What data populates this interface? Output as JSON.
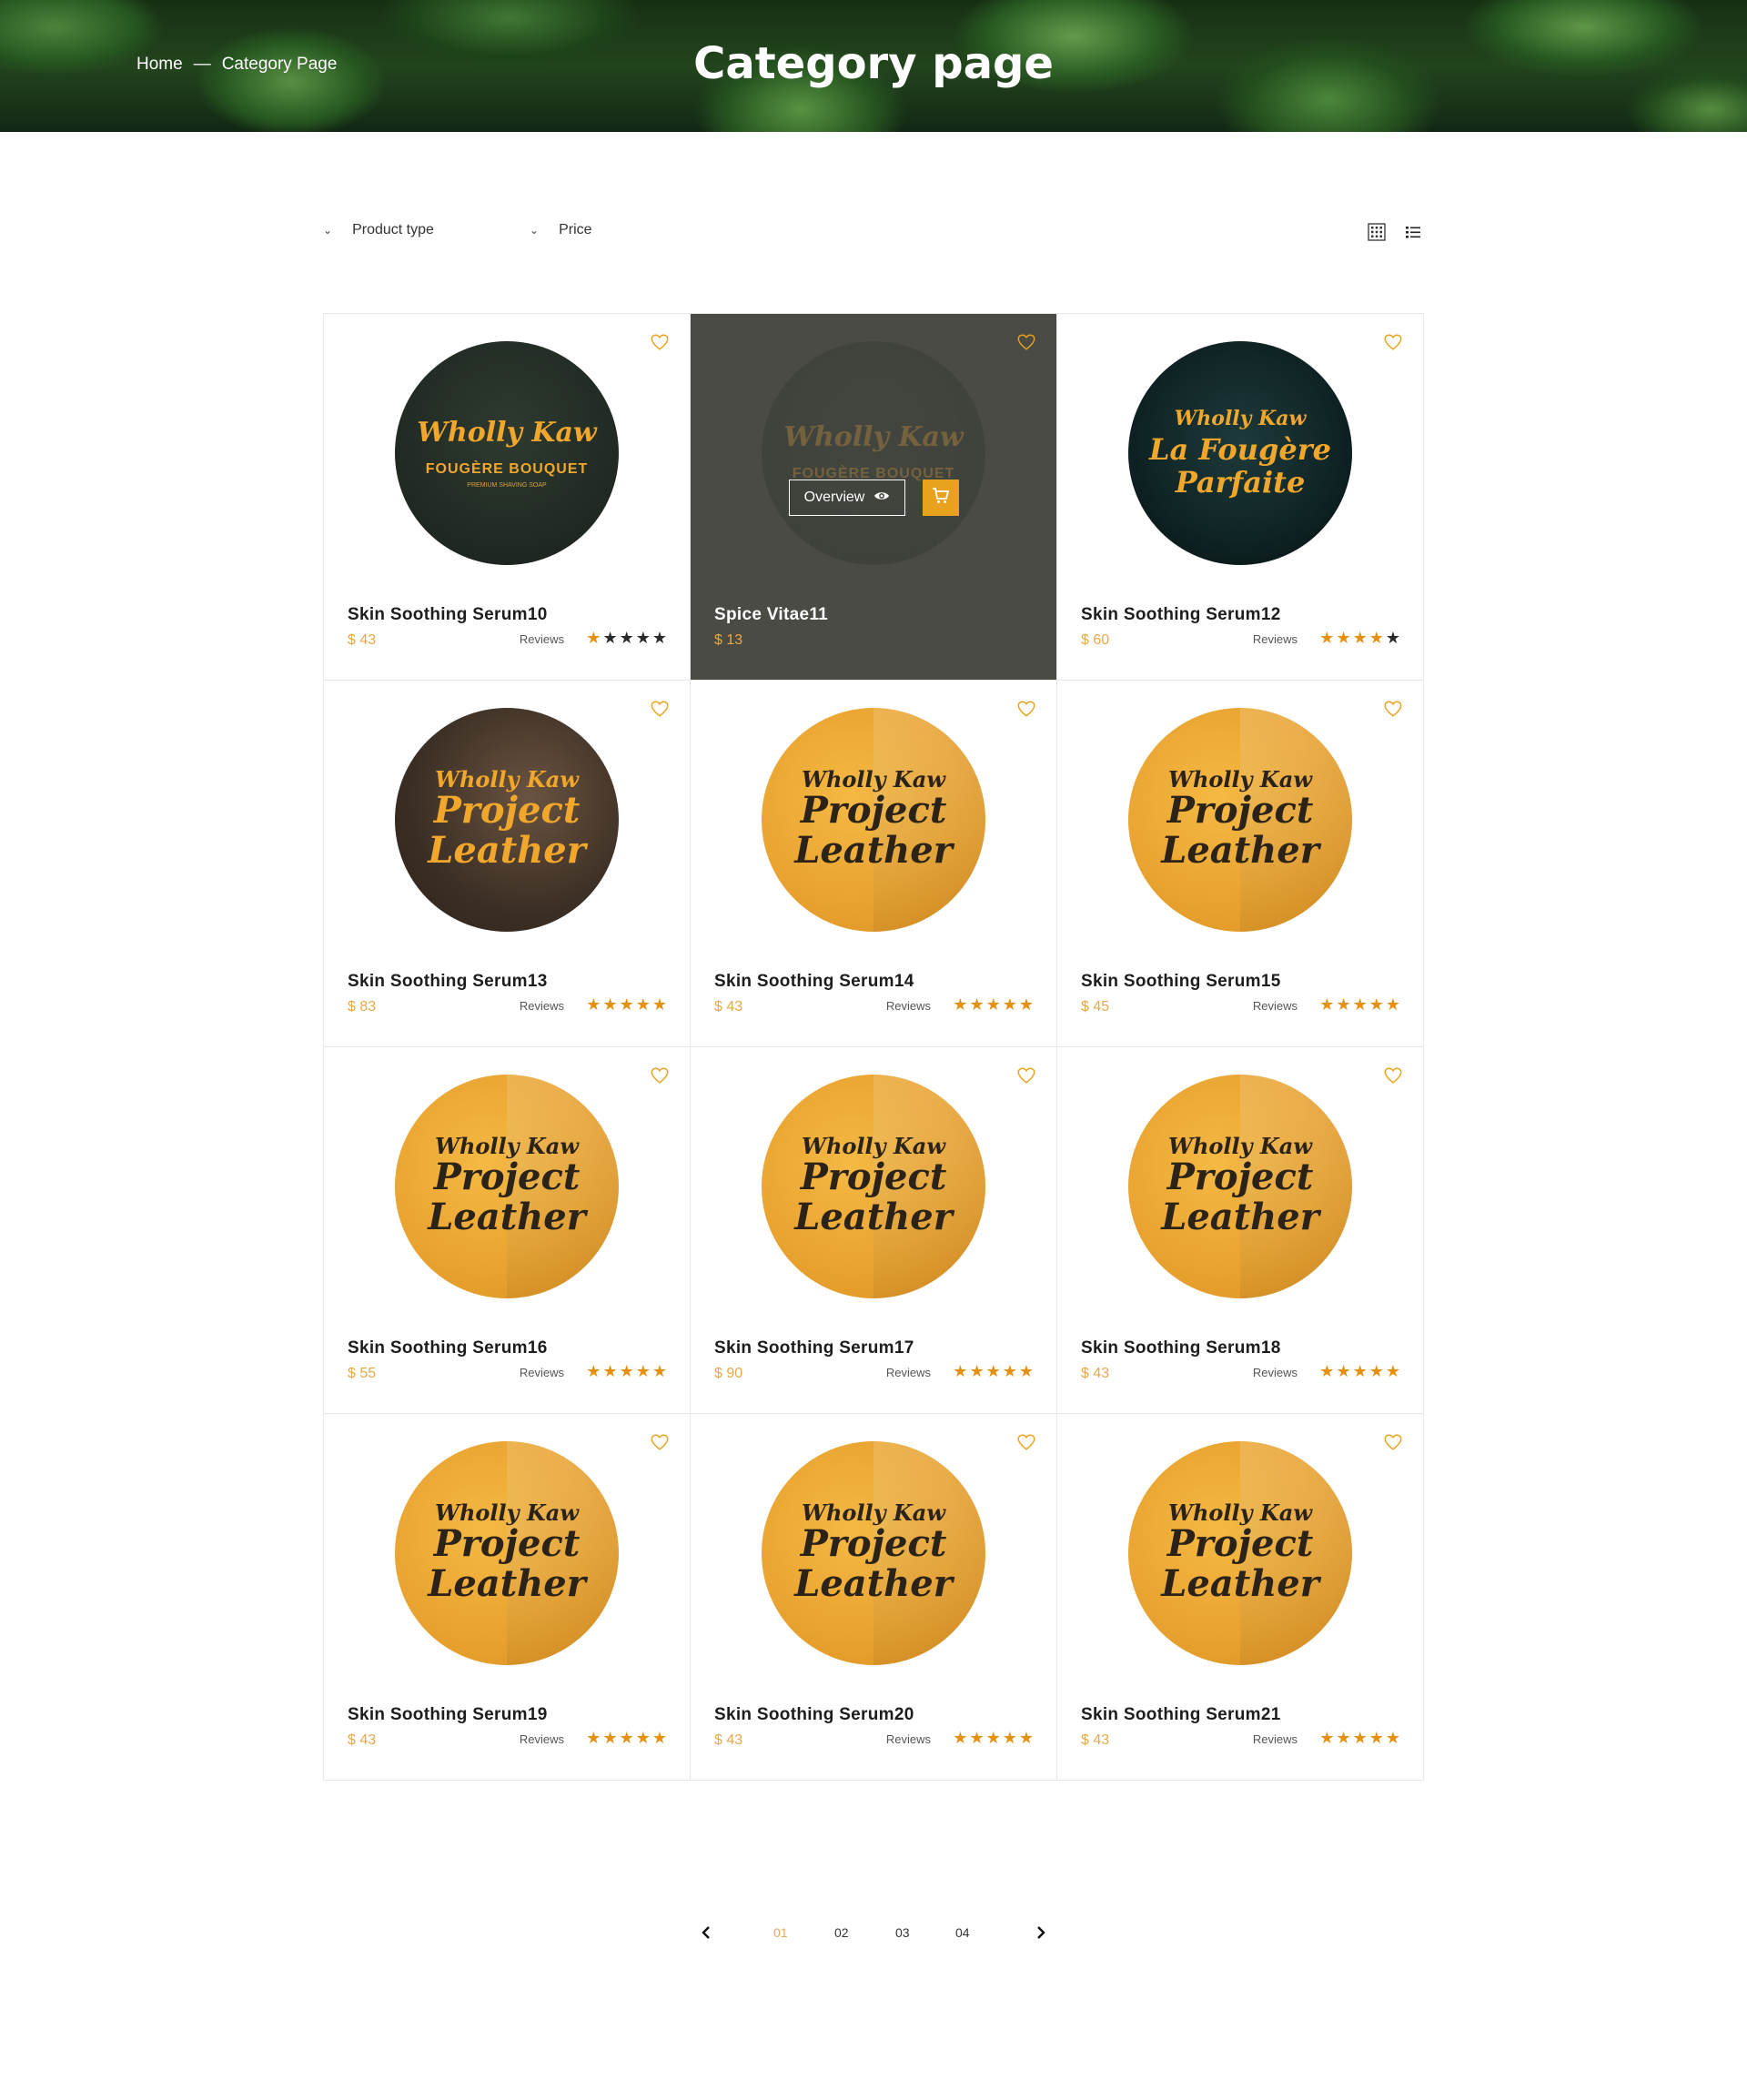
{
  "hero": {
    "breadcrumb": {
      "home": "Home",
      "separator": "—",
      "current": "Category Page"
    },
    "title": "Category page"
  },
  "filters": {
    "product_type": "Product type",
    "price": "Price"
  },
  "view_toggle": {
    "grid_icon": "grid-view-icon",
    "list_icon": "list-view-icon"
  },
  "colors": {
    "accent": "#e9a21e",
    "price": "#e7a84a",
    "star_on": "#e69010",
    "star_off": "#2a2a2a",
    "active_card": "#4b4b45"
  },
  "products": [
    {
      "name": "Skin Soothing Serum10",
      "price": "$ 43",
      "reviews": "Reviews",
      "rating": 1,
      "label_brand": "Wholly Kaw",
      "label_sub": "FOUGÈRE BOUQUET",
      "label_tiny": "PREMIUM SHAVING SOAP",
      "style": "dark"
    },
    {
      "name": "Spice Vitae11",
      "price": "$ 13",
      "reviews": "",
      "rating": null,
      "label_brand": "Wholly Kaw",
      "label_sub": "FOUGÈRE BOUQUET",
      "label_tiny": "",
      "style": "dark",
      "overview": "Overview"
    },
    {
      "name": "Skin Soothing Serum12",
      "price": "$ 60",
      "reviews": "Reviews",
      "rating": 4,
      "label_brand": "Wholly Kaw",
      "label_sub": "La Fougère Parfaite",
      "label_tiny": "",
      "style": "navy"
    },
    {
      "name": "Skin Soothing Serum13",
      "price": "$ 83",
      "reviews": "Reviews",
      "rating": 5,
      "label_brand": "Wholly Kaw",
      "label_sub": "Project Leather",
      "label_tiny": "",
      "style": "brown"
    },
    {
      "name": "Skin Soothing Serum14",
      "price": "$ 43",
      "reviews": "Reviews",
      "rating": 5,
      "label_brand": "Wholly Kaw",
      "label_sub": "Project Leather",
      "label_tiny": "",
      "style": "gold"
    },
    {
      "name": "Skin Soothing Serum15",
      "price": "$ 45",
      "reviews": "Reviews",
      "rating": 5,
      "label_brand": "Wholly Kaw",
      "label_sub": "Project Leather",
      "label_tiny": "",
      "style": "gold"
    },
    {
      "name": "Skin Soothing Serum16",
      "price": "$ 55",
      "reviews": "Reviews",
      "rating": 5,
      "label_brand": "Wholly Kaw",
      "label_sub": "Project Leather",
      "label_tiny": "",
      "style": "gold"
    },
    {
      "name": "Skin Soothing Serum17",
      "price": "$ 90",
      "reviews": "Reviews",
      "rating": 5,
      "label_brand": "Wholly Kaw",
      "label_sub": "Project Leather",
      "label_tiny": "",
      "style": "gold"
    },
    {
      "name": "Skin Soothing Serum18",
      "price": "$ 43",
      "reviews": "Reviews",
      "rating": 5,
      "label_brand": "Wholly Kaw",
      "label_sub": "Project Leather",
      "label_tiny": "",
      "style": "gold"
    },
    {
      "name": "Skin Soothing Serum19",
      "price": "$ 43",
      "reviews": "Reviews",
      "rating": 5,
      "label_brand": "Wholly Kaw",
      "label_sub": "Project Leather",
      "label_tiny": "",
      "style": "gold"
    },
    {
      "name": "Skin Soothing Serum20",
      "price": "$ 43",
      "reviews": "Reviews",
      "rating": 5,
      "label_brand": "Wholly Kaw",
      "label_sub": "Project Leather",
      "label_tiny": "",
      "style": "gold"
    },
    {
      "name": "Skin Soothing Serum21",
      "price": "$ 43",
      "reviews": "Reviews",
      "rating": 5,
      "label_brand": "Wholly Kaw",
      "label_sub": "Project Leather",
      "label_tiny": "",
      "style": "gold"
    }
  ],
  "pagination": {
    "pages": [
      "01",
      "02",
      "03",
      "04"
    ],
    "current": "01",
    "prev_icon": "chevron-left-icon",
    "next_icon": "chevron-right-icon"
  }
}
